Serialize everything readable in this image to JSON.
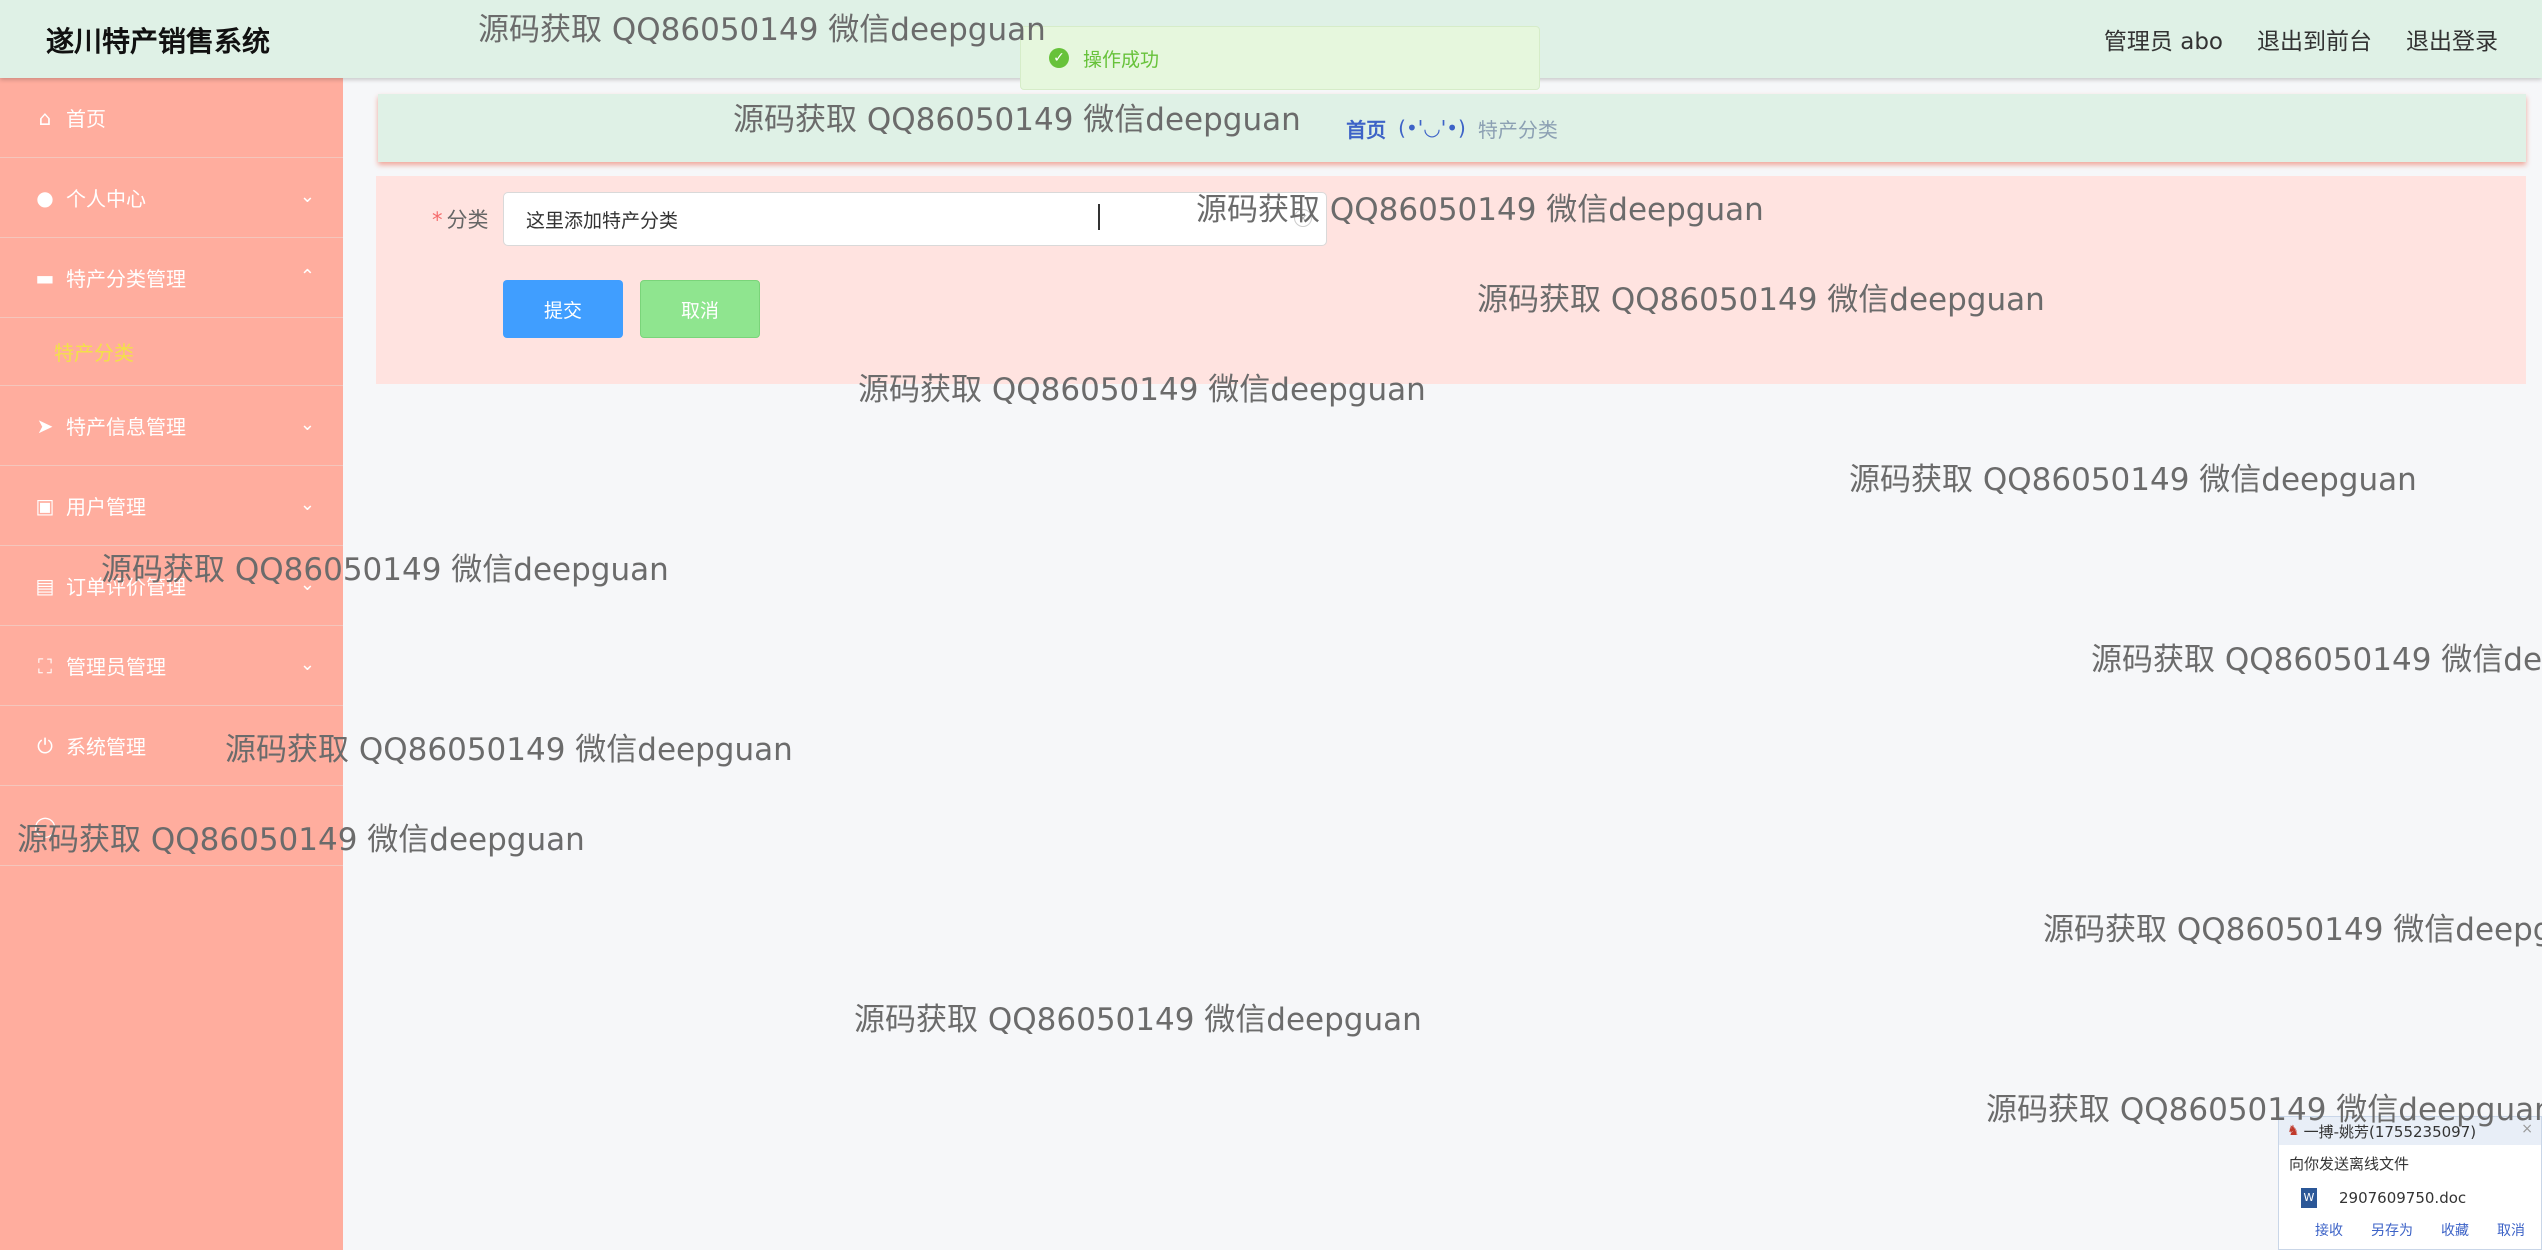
{
  "header": {
    "app_title": "遂川特产销售系统",
    "links": [
      "管理员 abo",
      "退出到前台",
      "退出登录"
    ]
  },
  "toast": {
    "message": "操作成功"
  },
  "sidebar": {
    "items": [
      {
        "label": "首页",
        "icon": "home-icon"
      },
      {
        "label": "个人中心",
        "icon": "user-icon"
      },
      {
        "label": "特产分类管理",
        "icon": "folder-icon",
        "expanded": true,
        "sub": [
          "特产分类"
        ]
      },
      {
        "label": "特产信息管理",
        "icon": "send-icon"
      },
      {
        "label": "用户管理",
        "icon": "wallet-icon"
      },
      {
        "label": "订单评价管理",
        "icon": "briefcase-icon"
      },
      {
        "label": "管理员管理",
        "icon": "frame-icon"
      },
      {
        "label": "系统管理",
        "icon": "power-icon"
      }
    ]
  },
  "breadcrumb": {
    "home": "首页",
    "sep": "(•'◡'•)",
    "current": "特产分类"
  },
  "form": {
    "label": "分类",
    "required_mark": "*",
    "value": "这里添加特产分类",
    "submit_label": "提交",
    "cancel_label": "取消"
  },
  "watermark": "源码获取 QQ86050149 微信deepguan",
  "qq_popup": {
    "title": "一搏-姚芳(1755235097)",
    "message": "向你发送离线文件",
    "file": "2907609750.doc",
    "actions": [
      "接收",
      "另存为",
      "收藏",
      "取消"
    ]
  },
  "colors": {
    "header_bg": "#dff1e6",
    "sidebar_bg": "#ffad9e",
    "submenu_active": "#f3e04a",
    "submit": "#409eff",
    "cancel": "#8fe58f",
    "success": "#67c23a"
  }
}
